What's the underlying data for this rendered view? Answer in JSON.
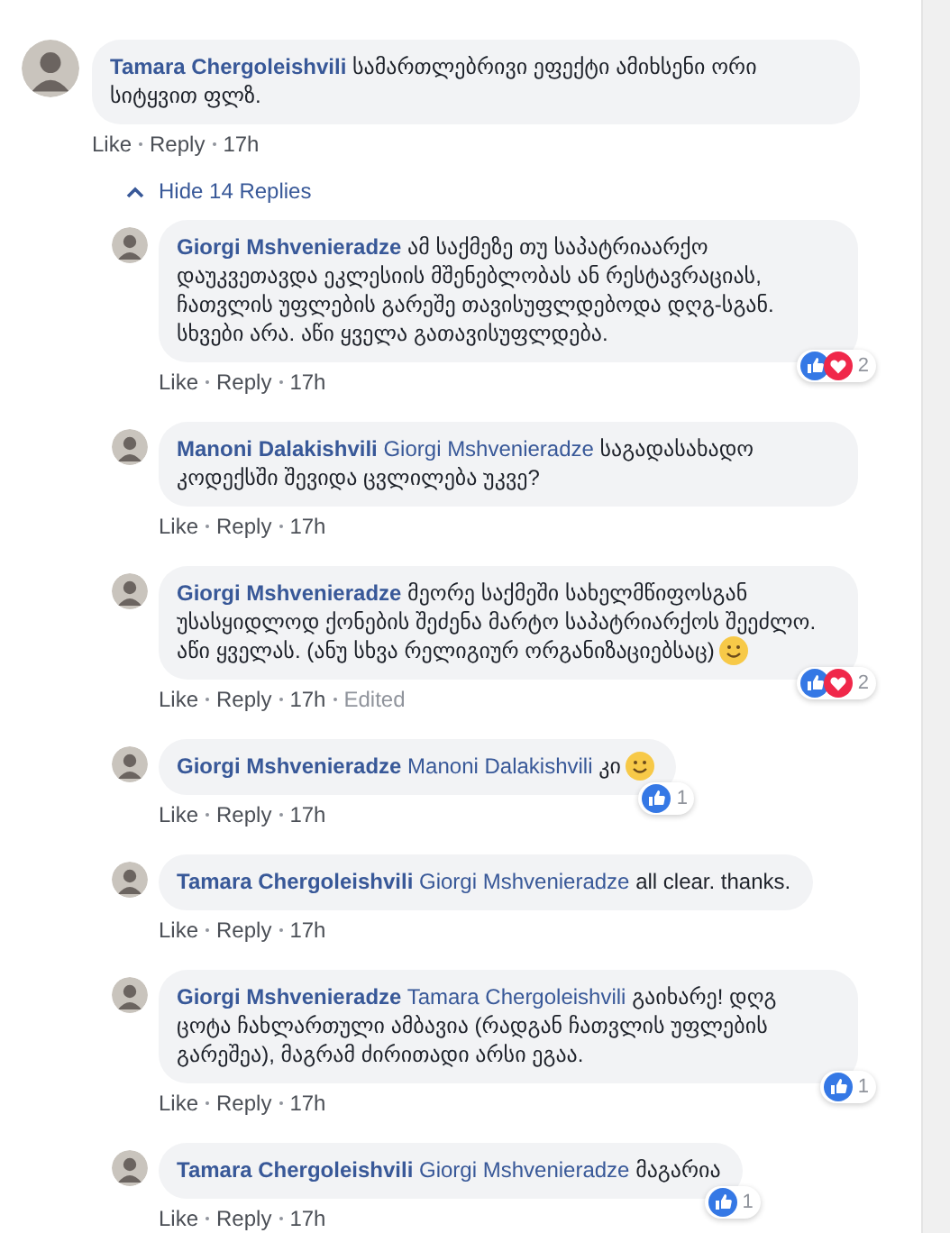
{
  "comment": {
    "author": "Tamara Chergoleishvili",
    "text": "სამართლებრივი ეფექტი ამიხსენი ორი სიტყვით ფლზ.",
    "meta": [
      "Like",
      "Reply",
      "17h"
    ]
  },
  "replies_toggle": {
    "label": "Hide 14 Replies",
    "expanded": true
  },
  "replies": [
    {
      "author": "Giorgi Mshvenieradze",
      "text": "ამ საქმეზე თუ საპატრიაარქო დაუკვეთავდა ეკლესიის მშენებლობას ან რესტავრაციას, ჩათვლის უფლების გარეშე თავისუფლდებოდა დღგ-სგან. სხვები არა. აწი ყველა გათავისუფლდება.",
      "meta": [
        "Like",
        "Reply",
        "17h"
      ],
      "reactions": {
        "like": true,
        "love": true,
        "count": "2"
      }
    },
    {
      "author": "Manoni Dalakishvili",
      "mention": "Giorgi Mshvenieradze",
      "text": "საგადასახადო კოდექსში შევიდა ცვლილება უკვე?",
      "meta": [
        "Like",
        "Reply",
        "17h"
      ]
    },
    {
      "author": "Giorgi Mshvenieradze",
      "text": "მეორე საქმეში სახელმწიფოსგან უსასყიდლოდ ქონების შეძენა მარტო საპატრიარქოს შეეძლო. აწი ყველას. (ანუ სხვა რელიგიურ ორგანიზაციებსაც)",
      "smiley": true,
      "meta": [
        "Like",
        "Reply",
        "17h",
        "Edited"
      ],
      "reactions": {
        "like": true,
        "love": true,
        "count": "2"
      }
    },
    {
      "author": "Giorgi Mshvenieradze",
      "mention": "Manoni Dalakishvili",
      "text": "კი",
      "smiley": true,
      "meta": [
        "Like",
        "Reply",
        "17h"
      ],
      "reactions": {
        "like": true,
        "love": false,
        "count": "1"
      }
    },
    {
      "author": "Tamara Chergoleishvili",
      "mention": "Giorgi Mshvenieradze",
      "text": "all clear. thanks.",
      "meta": [
        "Like",
        "Reply",
        "17h"
      ]
    },
    {
      "author": "Giorgi Mshvenieradze",
      "mention": "Tamara Chergoleishvili",
      "text": "გაიხარე! დღგ ცოტა ჩახლართული ამბავია (რადგან ჩათვლის უფლების გარეშეა), მაგრამ ძირითადი არსი ეგაა.",
      "meta": [
        "Like",
        "Reply",
        "17h"
      ],
      "reactions": {
        "like": true,
        "love": false,
        "count": "1"
      }
    },
    {
      "author": "Tamara Chergoleishvili",
      "mention": "Giorgi Mshvenieradze",
      "text": "მაგარია",
      "meta": [
        "Like",
        "Reply",
        "17h"
      ],
      "reactions": {
        "like": true,
        "love": false,
        "count": "1"
      }
    }
  ]
}
